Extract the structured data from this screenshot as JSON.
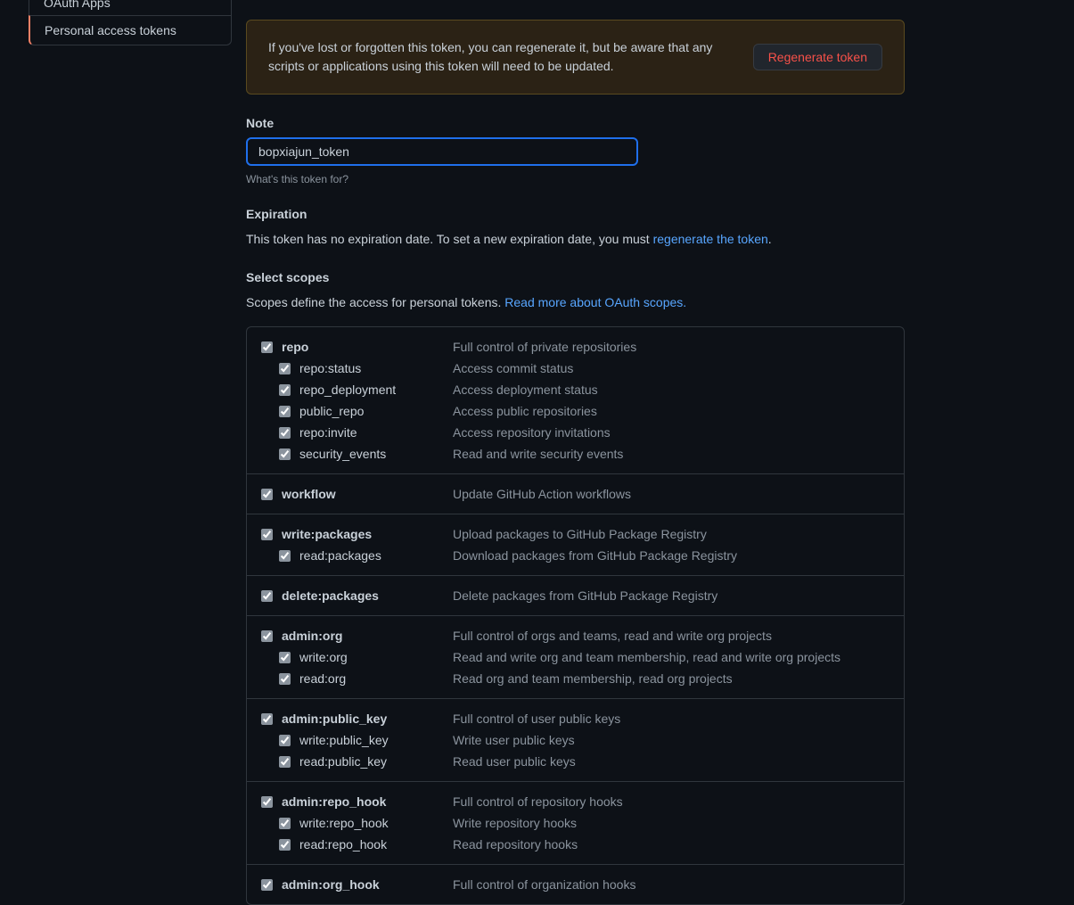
{
  "sidebar": {
    "items": [
      {
        "label": "OAuth Apps"
      },
      {
        "label": "Personal access tokens"
      }
    ]
  },
  "alert": {
    "text": "If you've lost or forgotten this token, you can regenerate it, but be aware that any scripts or applications using this token will need to be updated.",
    "button": "Regenerate token"
  },
  "note": {
    "label": "Note",
    "value": "bopxiajun_token",
    "hint": "What's this token for?"
  },
  "expiration": {
    "label": "Expiration",
    "text_pre": "This token has no expiration date. To set a new expiration date, you must ",
    "link": "regenerate the token",
    "text_post": "."
  },
  "scopes": {
    "label": "Select scopes",
    "desc_pre": "Scopes define the access for personal tokens. ",
    "link": "Read more about OAuth scopes.",
    "groups": [
      {
        "parent": {
          "name": "repo",
          "desc": "Full control of private repositories",
          "checked": true
        },
        "children": [
          {
            "name": "repo:status",
            "desc": "Access commit status",
            "checked": true
          },
          {
            "name": "repo_deployment",
            "desc": "Access deployment status",
            "checked": true
          },
          {
            "name": "public_repo",
            "desc": "Access public repositories",
            "checked": true
          },
          {
            "name": "repo:invite",
            "desc": "Access repository invitations",
            "checked": true
          },
          {
            "name": "security_events",
            "desc": "Read and write security events",
            "checked": true
          }
        ]
      },
      {
        "parent": {
          "name": "workflow",
          "desc": "Update GitHub Action workflows",
          "checked": true
        },
        "children": []
      },
      {
        "parent": {
          "name": "write:packages",
          "desc": "Upload packages to GitHub Package Registry",
          "checked": true
        },
        "children": [
          {
            "name": "read:packages",
            "desc": "Download packages from GitHub Package Registry",
            "checked": true
          }
        ]
      },
      {
        "parent": {
          "name": "delete:packages",
          "desc": "Delete packages from GitHub Package Registry",
          "checked": true
        },
        "children": []
      },
      {
        "parent": {
          "name": "admin:org",
          "desc": "Full control of orgs and teams, read and write org projects",
          "checked": true
        },
        "children": [
          {
            "name": "write:org",
            "desc": "Read and write org and team membership, read and write org projects",
            "checked": true
          },
          {
            "name": "read:org",
            "desc": "Read org and team membership, read org projects",
            "checked": true
          }
        ]
      },
      {
        "parent": {
          "name": "admin:public_key",
          "desc": "Full control of user public keys",
          "checked": true
        },
        "children": [
          {
            "name": "write:public_key",
            "desc": "Write user public keys",
            "checked": true
          },
          {
            "name": "read:public_key",
            "desc": "Read user public keys",
            "checked": true
          }
        ]
      },
      {
        "parent": {
          "name": "admin:repo_hook",
          "desc": "Full control of repository hooks",
          "checked": true
        },
        "children": [
          {
            "name": "write:repo_hook",
            "desc": "Write repository hooks",
            "checked": true
          },
          {
            "name": "read:repo_hook",
            "desc": "Read repository hooks",
            "checked": true
          }
        ]
      },
      {
        "parent": {
          "name": "admin:org_hook",
          "desc": "Full control of organization hooks",
          "checked": true
        },
        "children": []
      }
    ]
  }
}
